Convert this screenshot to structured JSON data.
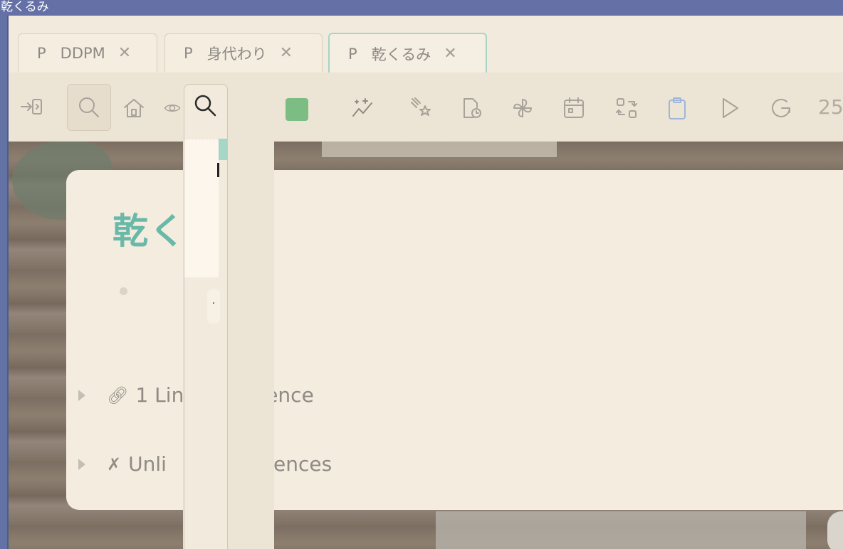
{
  "window": {
    "title": "乾くるみ"
  },
  "tabs": [
    {
      "prefix": "P",
      "label": "DDPM",
      "close": "✕",
      "active": false
    },
    {
      "prefix": "P",
      "label": "身代わり",
      "close": "✕",
      "active": false
    },
    {
      "prefix": "P",
      "label": "乾くるみ",
      "close": "✕",
      "active": true
    }
  ],
  "toolbar": {
    "icons": [
      "sidebar-toggle-icon",
      "search-icon",
      "home-icon",
      "eye-icon",
      "color-swatch",
      "graph-sparkle-icon",
      "stars-icon",
      "page-clock-icon",
      "pinwheel-icon",
      "calendar-icon",
      "swap-icon",
      "clipboard-icon",
      "play-icon",
      "refresh-icon"
    ],
    "swatch_color": "#7cbd83",
    "counter": "25"
  },
  "page": {
    "title": "乾く",
    "linked_refs": "1 Linked References",
    "linked_refs_visible_left": "1 Lin",
    "linked_refs_visible_right": "rence",
    "unlinked_refs": "Unlinked References",
    "unlinked_refs_visible_left": "Unli",
    "unlinked_refs_visible_right": "erences"
  },
  "popup": {
    "chip_text": "·"
  },
  "colors": {
    "accent": "#6ab9a8",
    "titlebar": "#6470a6"
  }
}
